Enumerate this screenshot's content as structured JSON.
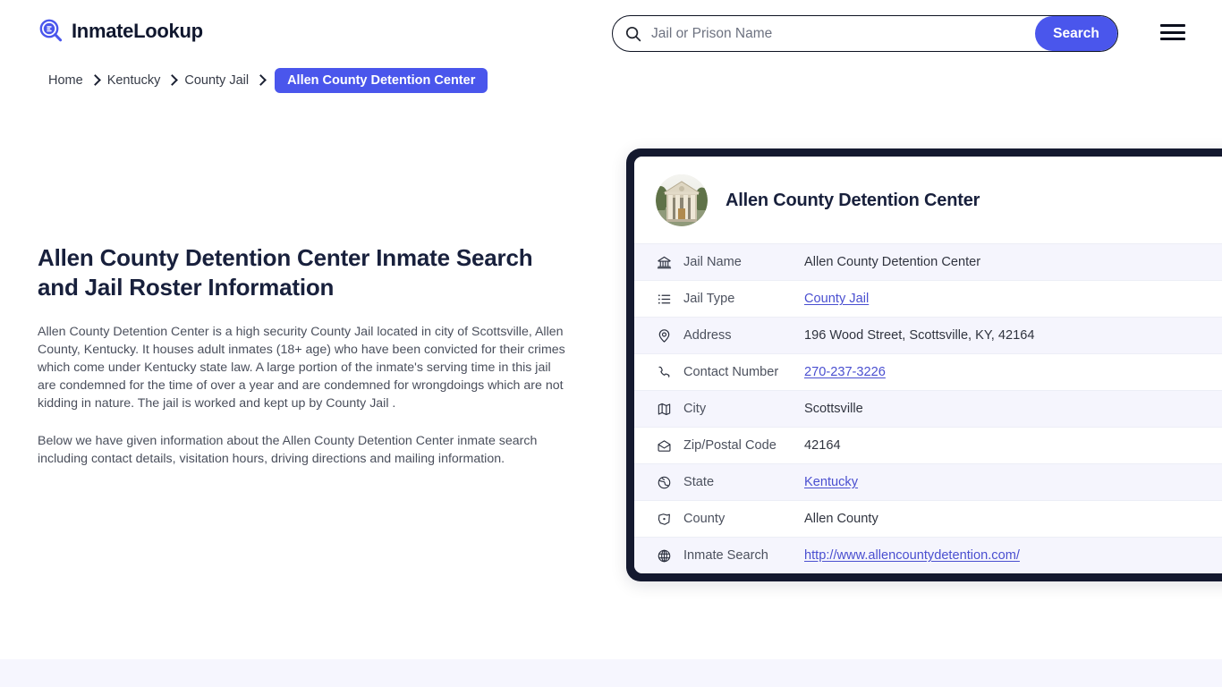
{
  "brand": {
    "name": "InmateLookup",
    "logo_icon": "magnifier-list-icon",
    "accent_color": "#4a56ec",
    "dark_color": "#14192f"
  },
  "search": {
    "placeholder": "Jail or Prison Name",
    "value": "",
    "button_label": "Search",
    "icon": "search-icon"
  },
  "menu": {
    "icon": "hamburger-menu-icon"
  },
  "breadcrumb": {
    "items": [
      {
        "label": "Home",
        "current": false
      },
      {
        "label": "Kentucky",
        "current": false
      },
      {
        "label": "County Jail",
        "current": false
      },
      {
        "label": "Allen County Detention Center",
        "current": true
      }
    ]
  },
  "main": {
    "heading": "Allen County Detention Center Inmate Search and Jail Roster Information",
    "paragraph_1": "Allen County Detention Center is a high security County Jail located in city of Scottsville, Allen County, Kentucky. It houses adult inmates (18+ age) who have been convicted for their crimes which come under Kentucky state law. A large portion of the inmate's serving time in this jail are condemned for the time of over a year and are condemned for wrongdoings which are not kidding in nature. The jail is worked and kept up by County Jail .",
    "paragraph_2": "Below we have given information about the Allen County Detention Center inmate search including contact details, visitation hours, driving directions and mailing information."
  },
  "card": {
    "title": "Allen County Detention Center",
    "avatar_icon": "courthouse-photo",
    "rows": [
      {
        "icon": "bank-icon",
        "label": "Jail Name",
        "value": "Allen County Detention Center",
        "link": false
      },
      {
        "icon": "list-icon",
        "label": "Jail Type",
        "value": "County Jail",
        "link": true
      },
      {
        "icon": "map-pin-icon",
        "label": "Address",
        "value": "196 Wood Street, Scottsville, KY, 42164",
        "link": false
      },
      {
        "icon": "phone-icon",
        "label": "Contact Number",
        "value": "270-237-3226",
        "link": true
      },
      {
        "icon": "map-icon",
        "label": "City",
        "value": "Scottsville",
        "link": false
      },
      {
        "icon": "envelope-icon",
        "label": "Zip/Postal Code",
        "value": "42164",
        "link": false
      },
      {
        "icon": "globe-icon",
        "label": "State",
        "value": "Kentucky",
        "link": true
      },
      {
        "icon": "region-icon",
        "label": "County",
        "value": "Allen County",
        "link": false
      },
      {
        "icon": "internet-icon",
        "label": "Inmate Search",
        "value": "http://www.allencountydetention.com/",
        "link": true
      }
    ]
  }
}
